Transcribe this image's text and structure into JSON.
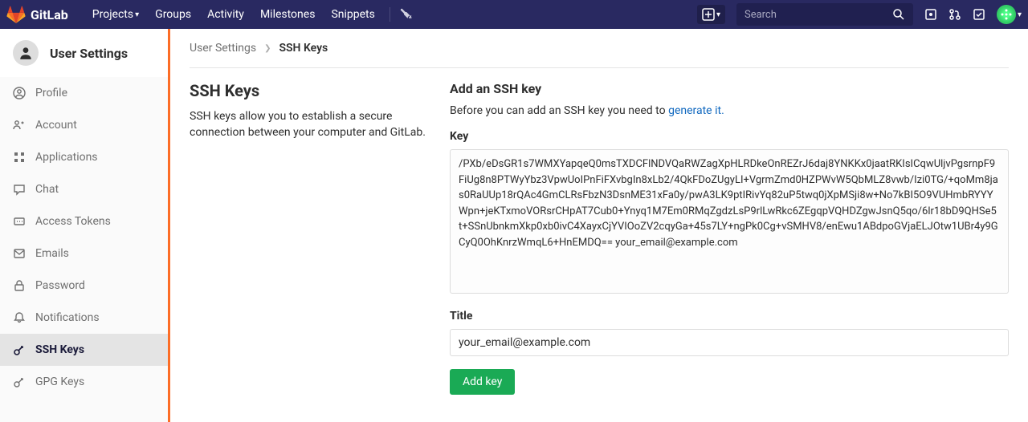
{
  "topbar": {
    "brand": "GitLab",
    "nav": {
      "projects": "Projects",
      "groups": "Groups",
      "activity": "Activity",
      "milestones": "Milestones",
      "snippets": "Snippets"
    },
    "search_placeholder": "Search"
  },
  "sidebar": {
    "title": "User Settings",
    "items": {
      "profile": "Profile",
      "account": "Account",
      "applications": "Applications",
      "chat": "Chat",
      "access_tokens": "Access Tokens",
      "emails": "Emails",
      "password": "Password",
      "notifications": "Notifications",
      "ssh_keys": "SSH Keys",
      "gpg_keys": "GPG Keys"
    }
  },
  "breadcrumb": {
    "parent": "User Settings",
    "current": "SSH Keys"
  },
  "section": {
    "title": "SSH Keys",
    "desc": "SSH keys allow you to establish a secure connection between your computer and GitLab."
  },
  "form": {
    "title": "Add an SSH key",
    "help_prefix": "Before you can add an SSH key you need to ",
    "help_link": "generate it.",
    "key_label": "Key",
    "key_value": "/PXb/eDsGR1s7WMXYapqeQ0msTXDCFlNDVQaRWZagXpHLRDkeOnREZrJ6daj8YNKKx0jaatRKIsICqwUljvPgsrnpF9FiUg8n8PTWyYbz3VpwUoIPnFiFXvbgIn8xLb2/4QkFDoZUgyLI+VgrmZmd0HZPWvW5QbMLZ8vwb/Izi0TG/+qoMm8jas0RaUUp18rQAc4GmCLRsFbzN3DsnME31xFa0y/pwA3LK9ptIRivYq82uP5twq0jXpMSji8w+No7kBI5O9VUHmbRYYYWpn+jeKTxmoVORsrCHpAT7Cub0+Ynyq1M7Em0RMqZgdzLsP9rlLwRkc6ZEgqpVQHDZgwJsnQ5qo/6lr18bD9QHSe5t+SSnUbnkmXkp0xb0ivC4XayxCjYVIOoZV2cqyGa+45s7LY+ngPk0Cg+vSMHV8/enEwu1ABdpoGVjaELJOtw1UBr4y9GCyQ0OhKnrzWmqL6+HnEMDQ== your_email@example.com",
    "title_label": "Title",
    "title_value": "your_email@example.com",
    "button": "Add key"
  }
}
